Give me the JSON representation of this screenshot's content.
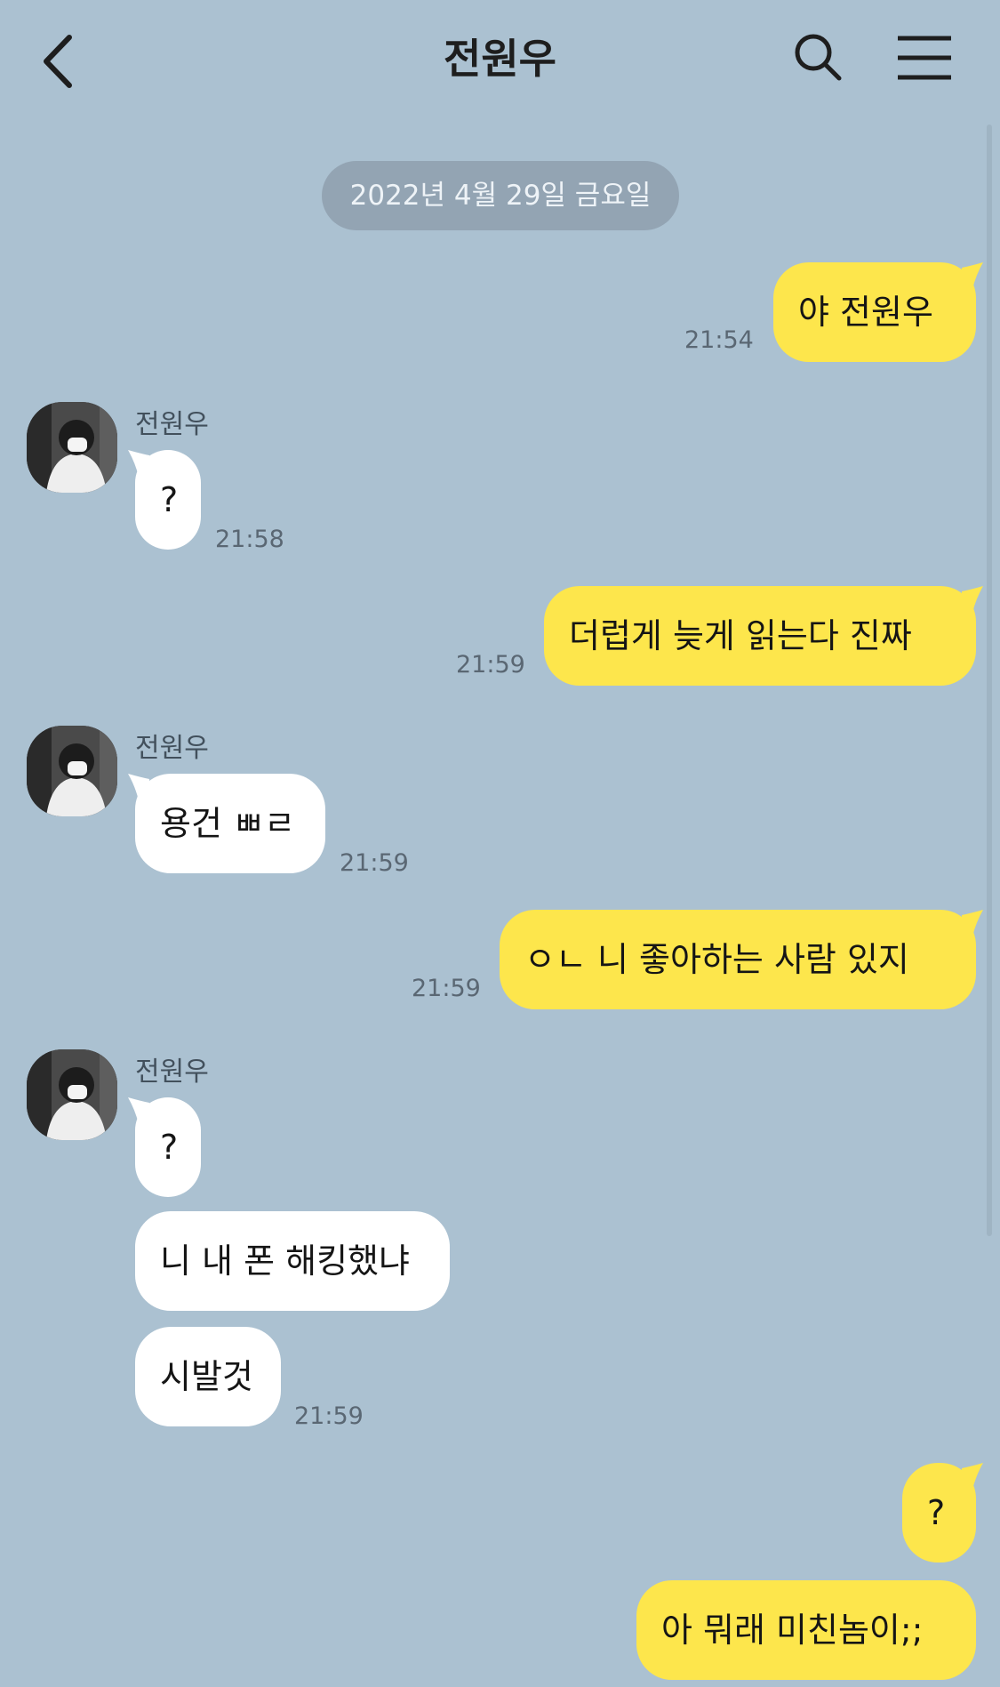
{
  "header": {
    "title": "전원우"
  },
  "date_divider": "2022년 4월 29일 금요일",
  "sender_name": "전원우",
  "messages": [
    {
      "text": "야 전원우",
      "time": "21:54"
    },
    {
      "text": "?",
      "time": "21:58"
    },
    {
      "text": "더럽게 늦게 읽는다 진짜",
      "time": "21:59"
    },
    {
      "text": "용건 ㅃㄹ",
      "time": "21:59"
    },
    {
      "text": "ㅇㄴ 니 좋아하는 사람 있지",
      "time": "21:59"
    },
    {
      "text": "?"
    },
    {
      "text": "니 내 폰 해킹했냐"
    },
    {
      "text": "시발것",
      "time": "21:59"
    },
    {
      "text": "?"
    },
    {
      "text": "아 뭐래 미친놈이;;"
    }
  ],
  "colors": {
    "background": "#abc1d1",
    "my_bubble": "#fde64c",
    "their_bubble": "#ffffff"
  }
}
